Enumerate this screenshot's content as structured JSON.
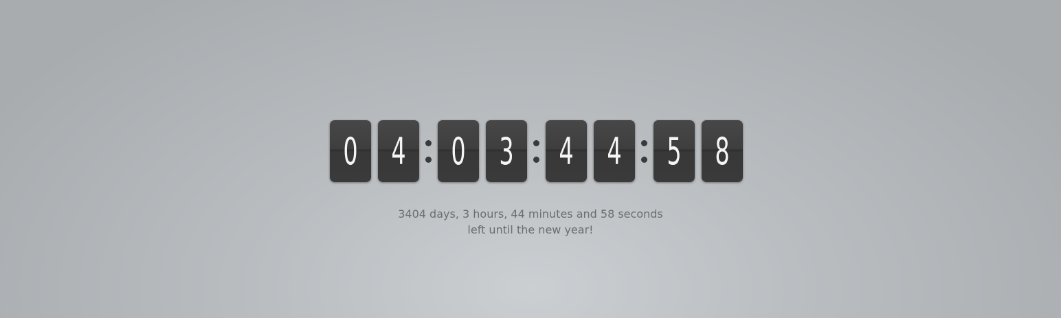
{
  "countdown": {
    "groups": [
      {
        "name": "days",
        "digits": [
          "0",
          "4"
        ]
      },
      {
        "name": "hours",
        "digits": [
          "0",
          "3"
        ]
      },
      {
        "name": "minutes",
        "digits": [
          "4",
          "4"
        ]
      },
      {
        "name": "seconds",
        "digits": [
          "5",
          "8"
        ]
      }
    ]
  },
  "note": {
    "line1": "3404 days, 3 hours, 44 minutes and 58 seconds",
    "line2": "left until the new year!"
  },
  "colors": {
    "digit_background": "#3b3b3b",
    "digit_text": "#f5f5f5",
    "separator_dot": "#3a3a3a",
    "note_text": "#6b6e70",
    "page_background": "#b9bdc0"
  }
}
